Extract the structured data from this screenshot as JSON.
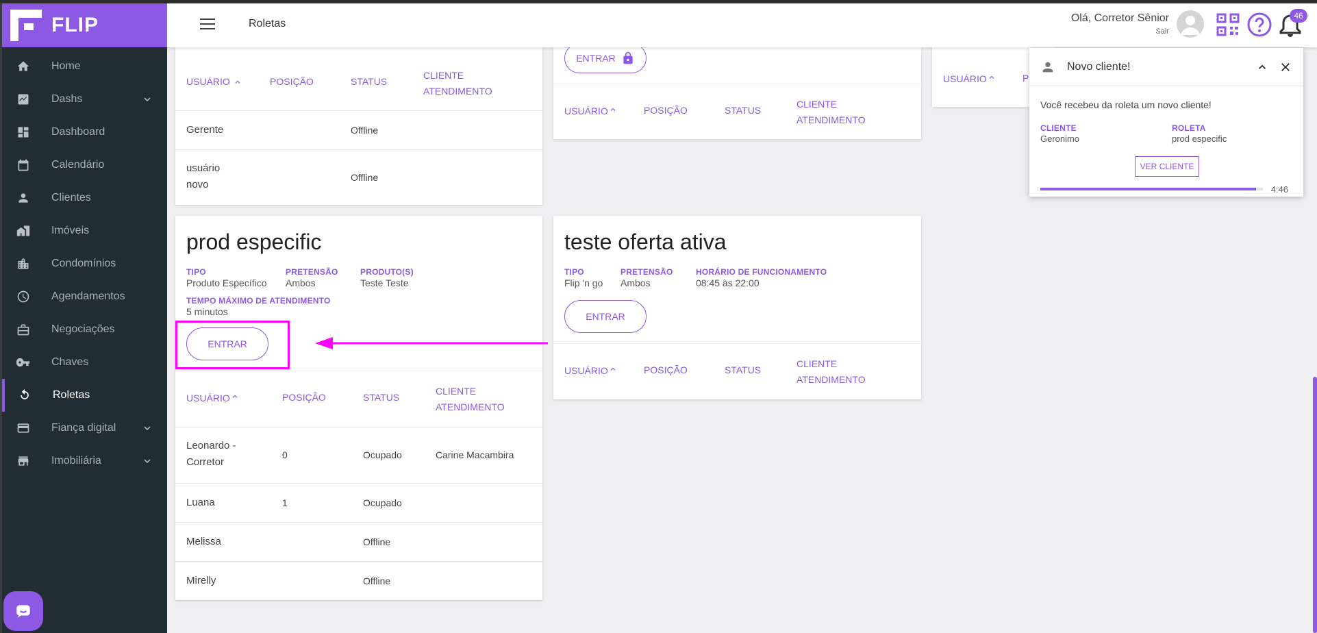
{
  "app": {
    "brand": "FLIP",
    "page_title": "Roletas"
  },
  "topbar": {
    "greeting": "Olá, Corretor Sênior",
    "logout": "Sair",
    "notification_count": "46"
  },
  "sidebar": {
    "items": [
      {
        "label": "Home",
        "icon": "home-icon"
      },
      {
        "label": "Dashs",
        "icon": "chart-icon",
        "expandable": true
      },
      {
        "label": "Dashboard",
        "icon": "dashboard-icon"
      },
      {
        "label": "Calendário",
        "icon": "calendar-icon"
      },
      {
        "label": "Clientes",
        "icon": "person-icon"
      },
      {
        "label": "Imóveis",
        "icon": "buildings-icon"
      },
      {
        "label": "Condomínios",
        "icon": "condo-icon"
      },
      {
        "label": "Agendamentos",
        "icon": "clock-icon"
      },
      {
        "label": "Negociações",
        "icon": "briefcase-icon"
      },
      {
        "label": "Chaves",
        "icon": "key-icon"
      },
      {
        "label": "Roletas",
        "icon": "roulette-icon",
        "active": true
      },
      {
        "label": "Fiança digital",
        "icon": "card-icon",
        "expandable": true
      },
      {
        "label": "Imobiliária",
        "icon": "store-icon",
        "expandable": true
      }
    ]
  },
  "table_headers": {
    "user": "USUÁRIO",
    "position": "POSIÇÃO",
    "status": "STATUS",
    "client_line1": "CLIENTE",
    "client_line2": "ATENDIMENTO"
  },
  "card_top_left": {
    "rows": [
      {
        "user": "Gerente",
        "position": "",
        "status": "Offline",
        "client": ""
      },
      {
        "user_line1": "usuário",
        "user_line2": "novo",
        "position": "",
        "status": "Offline",
        "client": ""
      }
    ]
  },
  "card_top_mid": {
    "enter_label": "ENTRAR",
    "locked": true
  },
  "card_prod": {
    "title": "prod especific",
    "fields": [
      {
        "label": "TIPO",
        "value": "Produto Específico"
      },
      {
        "label": "PRETENSÃO",
        "value": "Ambos"
      },
      {
        "label": "PRODUTO(S)",
        "value": "Teste Teste"
      },
      {
        "label": "TEMPO MÁXIMO DE ATENDIMENTO",
        "value": "5 minutos"
      }
    ],
    "enter_label": "ENTRAR",
    "rows": [
      {
        "user_line1": "Leonardo -",
        "user_line2": "Corretor",
        "position": "0",
        "status": "Ocupado",
        "client": "Carine Macambira"
      },
      {
        "user": "Luana",
        "position": "1",
        "status": "Ocupado",
        "client": ""
      },
      {
        "user": "Melissa",
        "position": "",
        "status": "Offline",
        "client": ""
      },
      {
        "user": "Mirelly",
        "position": "",
        "status": "Offline",
        "client": ""
      }
    ]
  },
  "card_oferta": {
    "title": "teste oferta ativa",
    "fields": [
      {
        "label": "TIPO",
        "value": "Flip 'n go"
      },
      {
        "label": "PRETENSÃO",
        "value": "Ambos"
      },
      {
        "label": "HORÁRIO DE FUNCIONAMENTO",
        "value": "08:45 às 22:00"
      }
    ],
    "enter_label": "ENTRAR"
  },
  "card_top_right": {
    "user_header": "USUÁRIO",
    "position_header_partial": "PO"
  },
  "notification": {
    "title": "Novo cliente!",
    "message": "Você recebeu da roleta um novo cliente!",
    "client_label": "CLIENTE",
    "client_value": "Geronimo",
    "roulette_label": "ROLETA",
    "roulette_value": "prod especific",
    "button": "VER CLIENTE",
    "timer": "4:46",
    "progress": 0.97
  },
  "colors": {
    "accent": "#8d59e4",
    "sidebar": "#222c33",
    "annotation": "#ff00ff"
  }
}
